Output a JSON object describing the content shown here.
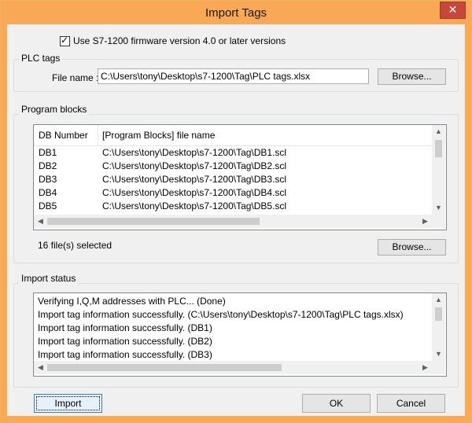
{
  "window": {
    "title": "Import Tags"
  },
  "title_bar": {
    "close_glyph": "✕"
  },
  "firmware_option": {
    "checked": true,
    "label": "Use S7-1200 firmware version 4.0 or later versions"
  },
  "plc_tags": {
    "group_label": "PLC tags",
    "file_name_label": "File name :",
    "file_name_value": "C:\\Users\\tony\\Desktop\\s7-1200\\Tag\\PLC tags.xlsx",
    "browse_label": "Browse..."
  },
  "program_blocks": {
    "group_label": "Program blocks",
    "columns": [
      "DB Number",
      "[Program Blocks] file name"
    ],
    "rows": [
      [
        "DB1",
        "C:\\Users\\tony\\Desktop\\s7-1200\\Tag\\DB1.scl"
      ],
      [
        "DB2",
        "C:\\Users\\tony\\Desktop\\s7-1200\\Tag\\DB2.scl"
      ],
      [
        "DB3",
        "C:\\Users\\tony\\Desktop\\s7-1200\\Tag\\DB3.scl"
      ],
      [
        "DB4",
        "C:\\Users\\tony\\Desktop\\s7-1200\\Tag\\DB4.scl"
      ],
      [
        "DB5",
        "C:\\Users\\tony\\Desktop\\s7-1200\\Tag\\DB5.scl"
      ]
    ],
    "selected_count_text": "16 file(s) selected",
    "browse_label": "Browse..."
  },
  "import_status": {
    "group_label": "Import status",
    "lines": [
      "Verifying I,Q,M addresses with PLC... (Done)",
      "Import tag information successfully. (C:\\Users\\tony\\Desktop\\s7-1200\\Tag\\PLC tags.xlsx)",
      "Import tag information successfully. (DB1)",
      "Import tag information successfully. (DB2)",
      "Import tag information successfully. (DB3)"
    ]
  },
  "buttons": {
    "import": "Import",
    "ok": "OK",
    "cancel": "Cancel"
  },
  "colors": {
    "title_bar": "#f9a855",
    "close_button": "#c7473b",
    "client_bg": "#f0f0f0"
  }
}
